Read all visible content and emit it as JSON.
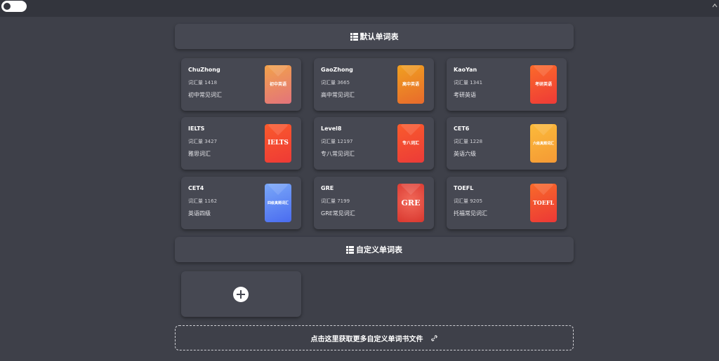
{
  "default_section": {
    "title": "默认单词表"
  },
  "custom_section": {
    "title": "自定义单词表"
  },
  "more_link": {
    "label": "点击这里获取更多自定义单词书文件"
  },
  "books": [
    {
      "name": "ChuZhong",
      "count": "词汇量 1418",
      "desc": "初中常见词汇",
      "cover_text": "初中英语",
      "cover_from": "#f2a24a",
      "cover_to": "#e3737b"
    },
    {
      "name": "GaoZhong",
      "count": "词汇量 3665",
      "desc": "高中常见词汇",
      "cover_text": "高中英语",
      "cover_from": "#f0a020",
      "cover_to": "#e86a2c"
    },
    {
      "name": "KaoYan",
      "count": "词汇量 1341",
      "desc": "考研英语",
      "cover_text": "考研英语",
      "cover_from": "#fb6a2a",
      "cover_to": "#ee3a37"
    },
    {
      "name": "IELTS",
      "count": "词汇量 3427",
      "desc": "雅思词汇",
      "cover_text": "IELTS",
      "cover_from": "#fa5a2c",
      "cover_to": "#ee3a36"
    },
    {
      "name": "Level8",
      "count": "词汇量 12197",
      "desc": "专八常见词汇",
      "cover_text": "专八词汇",
      "cover_from": "#f95b2c",
      "cover_to": "#ec3b38"
    },
    {
      "name": "CET6",
      "count": "词汇量 1228",
      "desc": "英语六级",
      "cover_text": "六级真题词汇",
      "cover_from": "#fbba3a",
      "cover_to": "#f59a35"
    },
    {
      "name": "CET4",
      "count": "词汇量 1162",
      "desc": "英语四级",
      "cover_text": "四级真题词汇",
      "cover_from": "#7aa8f8",
      "cover_to": "#4a6cf0"
    },
    {
      "name": "GRE",
      "count": "词汇量 7199",
      "desc": "GRE常见词汇",
      "cover_text": "GRE",
      "cover_from": "#e94a4a",
      "cover_to": "#d8362e"
    },
    {
      "name": "TOEFL",
      "count": "词汇量 9205",
      "desc": "托福常见词汇",
      "cover_text": "TOEFL",
      "cover_from": "#f86a2a",
      "cover_to": "#ec3836"
    }
  ]
}
